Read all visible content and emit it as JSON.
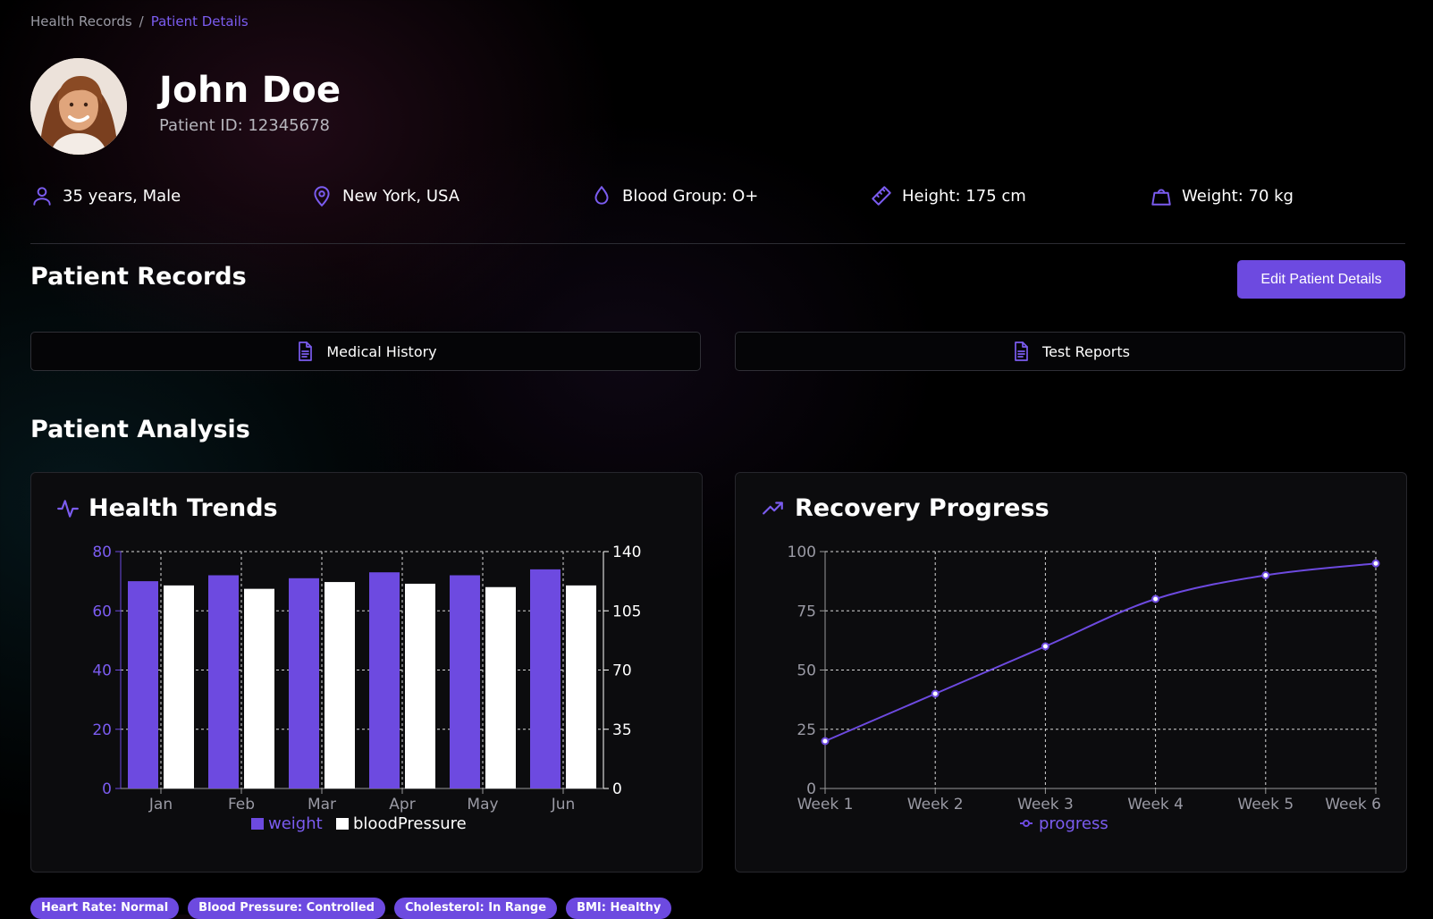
{
  "breadcrumb": {
    "root": "Health Records",
    "separator": "/",
    "current": "Patient Details"
  },
  "patient": {
    "name": "John Doe",
    "id_label": "Patient ID: 12345678",
    "avatar_icon": "avatar-photo"
  },
  "info": [
    {
      "icon": "user-icon",
      "text": "35 years, Male"
    },
    {
      "icon": "map-pin-icon",
      "text": "New York, USA"
    },
    {
      "icon": "droplet-icon",
      "text": "Blood Group: O+"
    },
    {
      "icon": "ruler-icon",
      "text": "Height: 175 cm"
    },
    {
      "icon": "weight-icon",
      "text": "Weight: 70 kg"
    }
  ],
  "records": {
    "title": "Patient Records",
    "edit_label": "Edit Patient Details",
    "buttons": [
      {
        "icon": "file-text-icon",
        "label": "Medical History"
      },
      {
        "icon": "file-text-icon",
        "label": "Test Reports"
      }
    ]
  },
  "analysis": {
    "title": "Patient Analysis",
    "health_trends_title": "Health Trends",
    "recovery_title": "Recovery Progress"
  },
  "colors": {
    "accent": "#6d4ae0",
    "accent_light": "#7b5cf0",
    "bar_secondary": "#ffffff",
    "background": "#000000",
    "card": "#0c0c0e"
  },
  "chart_data": [
    {
      "type": "bar",
      "categories": [
        "Jan",
        "Feb",
        "Mar",
        "Apr",
        "May",
        "Jun"
      ],
      "series": [
        {
          "name": "weight",
          "axis": "left",
          "values": [
            70,
            72,
            71,
            73,
            72,
            74
          ]
        },
        {
          "name": "bloodPressure",
          "axis": "right",
          "values": [
            120,
            118,
            122,
            121,
            119,
            120
          ]
        }
      ],
      "left_axis": {
        "ylim": [
          0,
          80
        ],
        "ticks": [
          "0",
          "20",
          "40",
          "60",
          "80"
        ]
      },
      "right_axis": {
        "ylim": [
          0,
          140
        ],
        "ticks": [
          "0",
          "35",
          "70",
          "105",
          "140"
        ]
      },
      "grid": true,
      "legend": "bottom"
    },
    {
      "type": "line",
      "x": [
        "Week 1",
        "Week 2",
        "Week 3",
        "Week 4",
        "Week 5",
        "Week 6"
      ],
      "series": [
        {
          "name": "progress",
          "values": [
            20,
            40,
            60,
            80,
            90,
            95
          ]
        }
      ],
      "ylim": [
        0,
        100
      ],
      "yticks": [
        "0",
        "25",
        "50",
        "75",
        "100"
      ],
      "grid": true,
      "legend": "bottom"
    }
  ],
  "badges": [
    "Heart Rate: Normal",
    "Blood Pressure: Controlled",
    "Cholesterol: In Range",
    "BMI: Healthy"
  ]
}
